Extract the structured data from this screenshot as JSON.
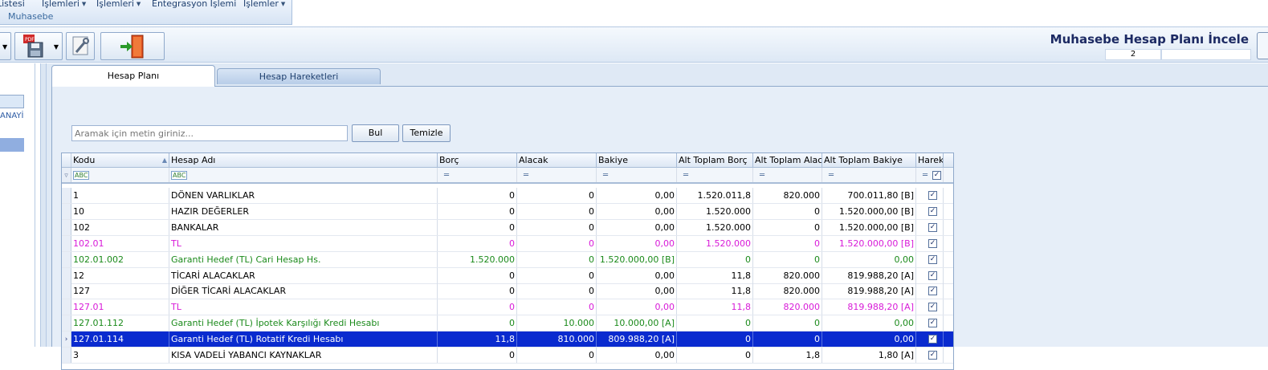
{
  "ribbon": {
    "menu": [
      {
        "label": "Listesi",
        "arrow": false
      },
      {
        "label": "İşlemleri",
        "arrow": true
      },
      {
        "label": "İşlemleri",
        "arrow": true
      },
      {
        "label": "Entegrasyon İşlemi",
        "arrow": false
      },
      {
        "label": "İşlemler",
        "arrow": true
      }
    ],
    "sub": "Muhasebe"
  },
  "header": {
    "title": "Muhasebe Hesap Planı İncele",
    "sub_value": "2"
  },
  "left": {
    "text": "ANAYİ"
  },
  "tabs": [
    {
      "label": "Hesap Planı",
      "active": true
    },
    {
      "label": "Hesap Hareketleri",
      "active": false
    }
  ],
  "search": {
    "placeholder": "Aramak için metin giriniz...",
    "find_label": "Bul",
    "clear_label": "Temizle"
  },
  "grid": {
    "columns": [
      "Kodu",
      "Hesap Adı",
      "Borç",
      "Alacak",
      "Bakiye",
      "Alt Toplam Borç",
      "Alt Toplam Alacak",
      "Alt Toplam Bakiye",
      "Hareket"
    ],
    "filter_icons": [
      "abc-filter-icon",
      "abc-filter-icon",
      "equals-icon",
      "equals-icon",
      "equals-icon",
      "equals-icon",
      "equals-icon",
      "equals-icon",
      "equals-icon"
    ],
    "rows": [
      {
        "kod": "1",
        "ad": "DÖNEN VARLIKLAR",
        "borc": "0",
        "alacak": "0",
        "bakiye": "0,00",
        "atb": "1.520.011,8",
        "ata": "820.000",
        "atbak": "700.011,80 [B]",
        "style": "normal"
      },
      {
        "kod": "10",
        "ad": "HAZIR DEĞERLER",
        "borc": "0",
        "alacak": "0",
        "bakiye": "0,00",
        "atb": "1.520.000",
        "ata": "0",
        "atbak": "1.520.000,00 [B]",
        "style": "normal"
      },
      {
        "kod": "102",
        "ad": "BANKALAR",
        "borc": "0",
        "alacak": "0",
        "bakiye": "0,00",
        "atb": "1.520.000",
        "ata": "0",
        "atbak": "1.520.000,00 [B]",
        "style": "normal"
      },
      {
        "kod": "102.01",
        "ad": "TL",
        "borc": "0",
        "alacak": "0",
        "bakiye": "0,00",
        "atb": "1.520.000",
        "ata": "0",
        "atbak": "1.520.000,00 [B]",
        "style": "pink"
      },
      {
        "kod": "102.01.002",
        "ad": "Garanti Hedef (TL) Cari Hesap Hs.",
        "borc": "1.520.000",
        "alacak": "0",
        "bakiye": "1.520.000,00 [B]",
        "atb": "0",
        "ata": "0",
        "atbak": "0,00",
        "style": "green"
      },
      {
        "kod": "12",
        "ad": "TİCARİ ALACAKLAR",
        "borc": "0",
        "alacak": "0",
        "bakiye": "0,00",
        "atb": "11,8",
        "ata": "820.000",
        "atbak": "819.988,20 [A]",
        "style": "normal"
      },
      {
        "kod": "127",
        "ad": "DİĞER TİCARİ ALACAKLAR",
        "borc": "0",
        "alacak": "0",
        "bakiye": "0,00",
        "atb": "11,8",
        "ata": "820.000",
        "atbak": "819.988,20 [A]",
        "style": "normal"
      },
      {
        "kod": "127.01",
        "ad": "TL",
        "borc": "0",
        "alacak": "0",
        "bakiye": "0,00",
        "atb": "11,8",
        "ata": "820.000",
        "atbak": "819.988,20 [A]",
        "style": "pink"
      },
      {
        "kod": "127.01.112",
        "ad": "Garanti Hedef (TL) İpotek Karşılığı Kredi Hesabı",
        "borc": "0",
        "alacak": "10.000",
        "bakiye": "10.000,00 [A]",
        "atb": "0",
        "ata": "0",
        "atbak": "0,00",
        "style": "green"
      },
      {
        "kod": "127.01.114",
        "ad": "Garanti Hedef (TL) Rotatif Kredi Hesabı",
        "borc": "11,8",
        "alacak": "810.000",
        "bakiye": "809.988,20 [A]",
        "atb": "0",
        "ata": "0",
        "atbak": "0,00",
        "style": "selected"
      },
      {
        "kod": "3",
        "ad": "KISA VADELİ YABANCI KAYNAKLAR",
        "borc": "0",
        "alacak": "0",
        "bakiye": "0,00",
        "atb": "0",
        "ata": "1,8",
        "atbak": "1,80 [A]",
        "style": "normal"
      }
    ]
  },
  "colors": {
    "pink": "#d81ad8",
    "green": "#1b8a1b",
    "selected": "#0a2bcf",
    "title": "#1c2a63"
  }
}
